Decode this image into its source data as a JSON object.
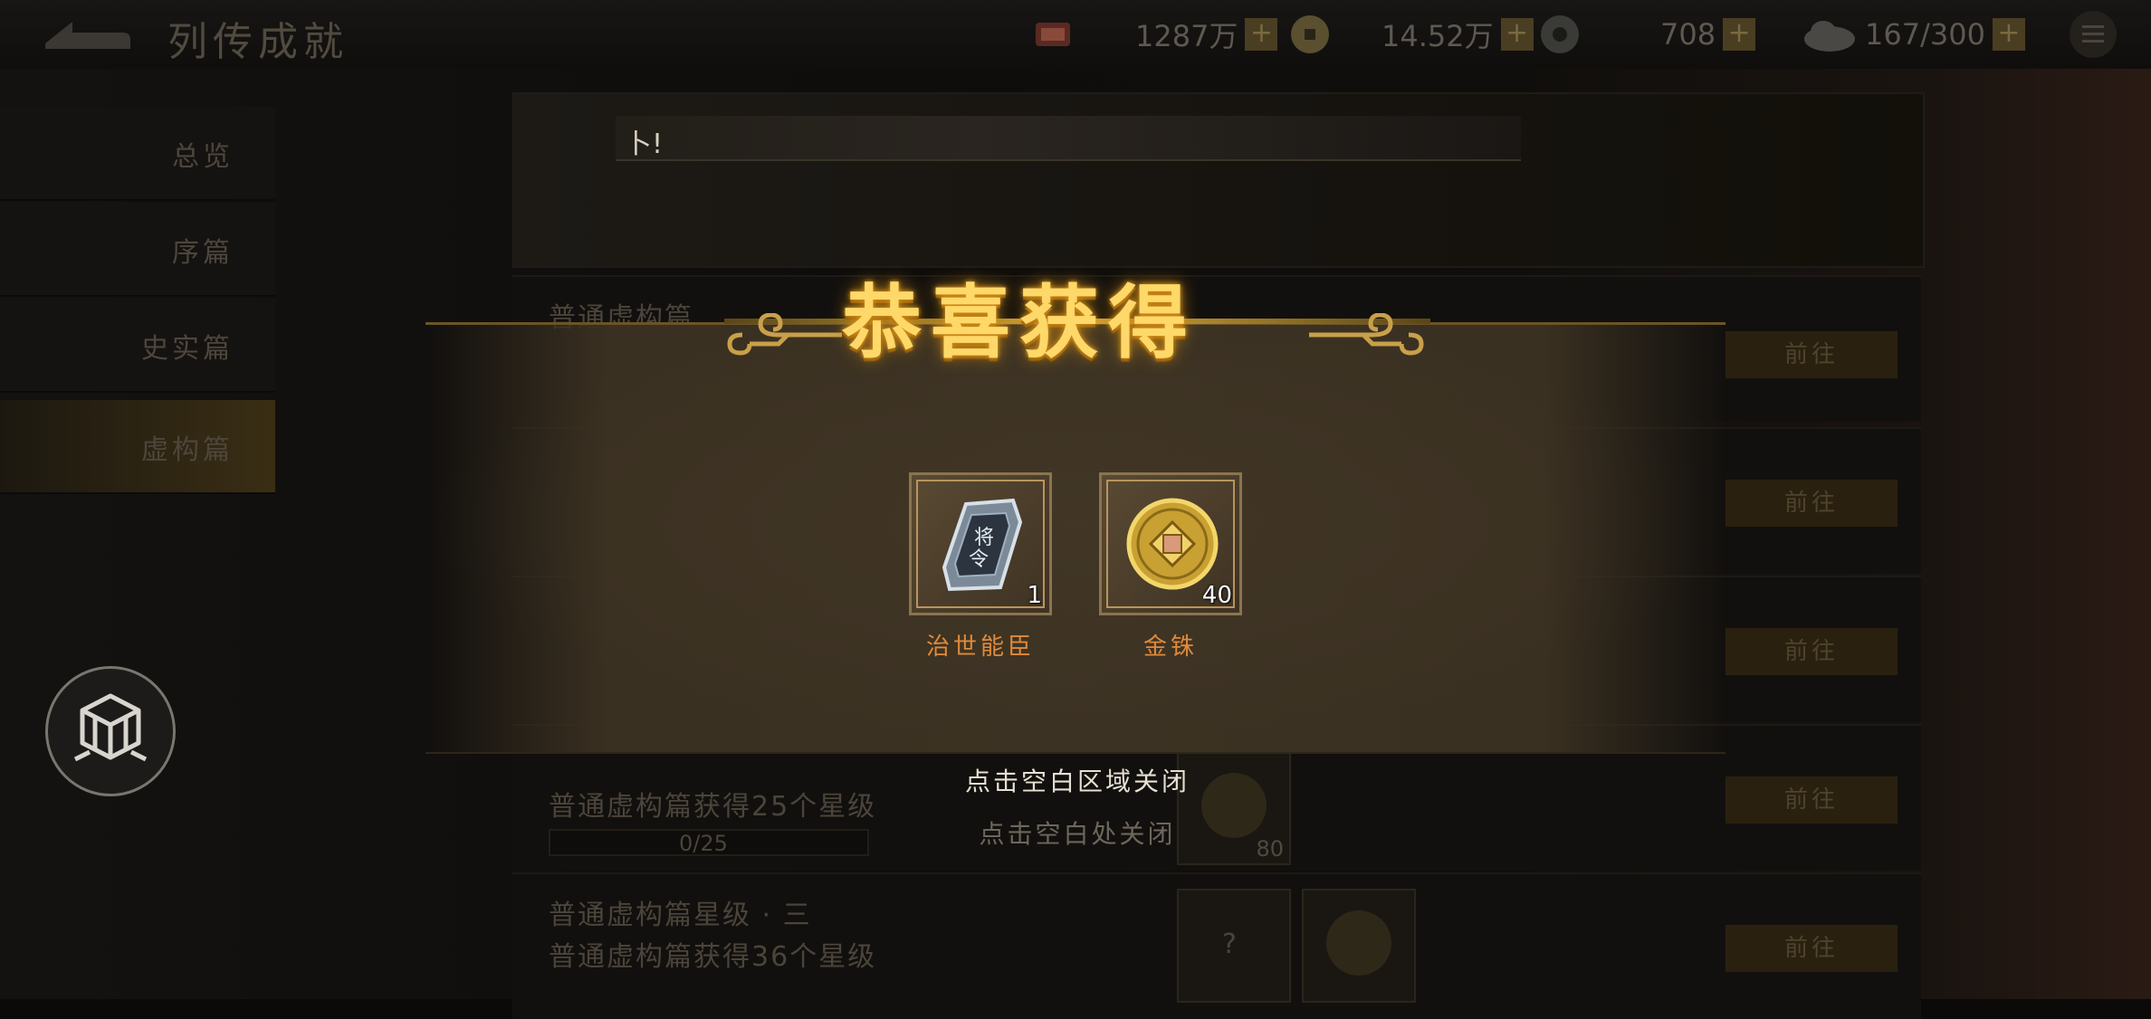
{
  "header": {
    "title": "列传成就",
    "resources": [
      {
        "icon": "stamina-icon",
        "value": "1287万"
      },
      {
        "icon": "coin-icon",
        "value": "14.52万"
      },
      {
        "icon": "jade-icon",
        "value": "708"
      },
      {
        "icon": "cloud-icon",
        "value": "167/300"
      }
    ],
    "plus": "+"
  },
  "sidebar": {
    "items": [
      {
        "label": "总览"
      },
      {
        "label": "序篇"
      },
      {
        "label": "史实篇"
      },
      {
        "label": "虚构篇"
      }
    ]
  },
  "banner": {
    "text": "卜!"
  },
  "list": {
    "go_label": "前往",
    "rows": [
      {
        "title": "普通虚构篇"
      },
      {
        "title": "普通虚构篇获得25个星级",
        "progress": "0/25",
        "reward_count": "80"
      },
      {
        "title": "普通虚构篇星级 · 三",
        "subtitle": "普通虚构篇获得36个星级",
        "reward_unknown": "?"
      }
    ]
  },
  "popup": {
    "title": "恭喜获得",
    "rewards": [
      {
        "name": "治世能臣",
        "count": "1",
        "icon": "token-icon"
      },
      {
        "name": "金铢",
        "count": "40",
        "icon": "gold-coin-icon"
      }
    ],
    "close_hint": "点击空白区域关闭",
    "close_hint_sub": "点击空白处关闭"
  },
  "colors": {
    "accent_gold": "#ffd86a",
    "reward_name": "#e08a3a",
    "popup_bg": "#3c3223"
  }
}
